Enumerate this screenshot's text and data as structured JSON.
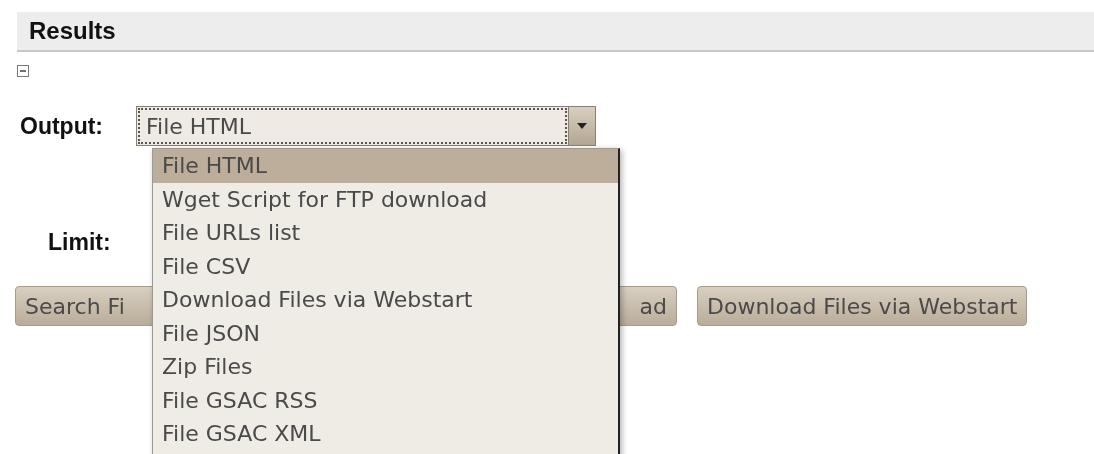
{
  "section": {
    "title": "Results",
    "collapsed": false
  },
  "output": {
    "label": "Output:",
    "value": "File HTML",
    "expanded": true,
    "options": [
      {
        "label": "File HTML",
        "selected": true
      },
      {
        "label": "Wget Script for FTP download",
        "selected": false
      },
      {
        "label": "File URLs list",
        "selected": false
      },
      {
        "label": "File CSV",
        "selected": false
      },
      {
        "label": "Download Files via Webstart",
        "selected": false
      },
      {
        "label": "File JSON",
        "selected": false
      },
      {
        "label": "Zip Files",
        "selected": false
      },
      {
        "label": "File GSAC RSS",
        "selected": false
      },
      {
        "label": "File GSAC XML",
        "selected": false
      }
    ]
  },
  "limit": {
    "label": "Limit:"
  },
  "buttons": [
    "Search Fi",
    "ad",
    "Download Files via Webstart"
  ]
}
